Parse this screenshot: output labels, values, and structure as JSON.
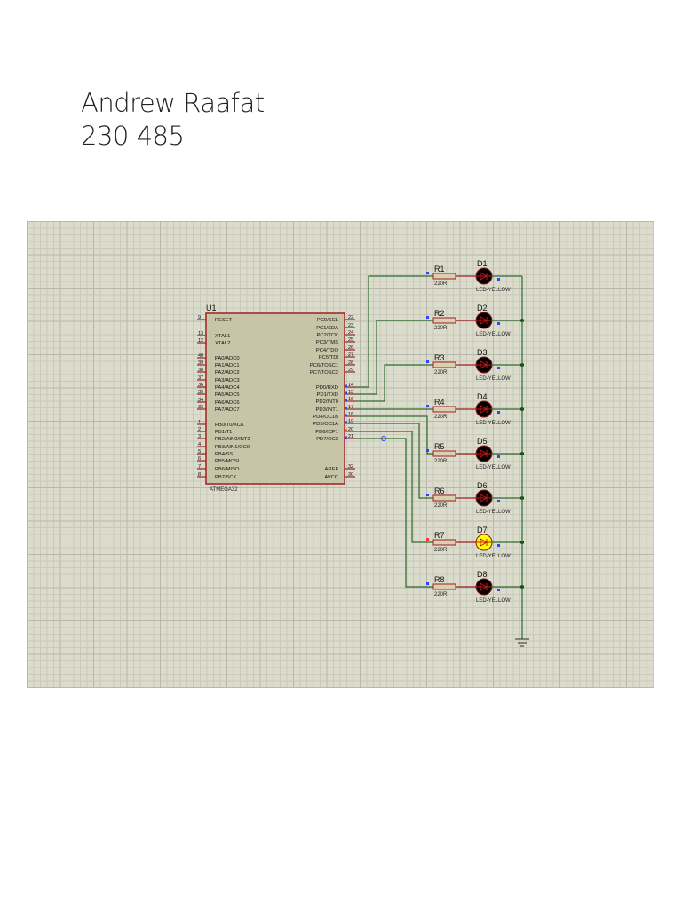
{
  "author": {
    "name": "Andrew Raafat",
    "id": "230 485"
  },
  "schematic": {
    "chip": {
      "ref": "U1",
      "part": "ATMEGA32",
      "left_pins": [
        {
          "num": "9",
          "name": "RESET"
        },
        {
          "num": "13",
          "name": "XTAL1"
        },
        {
          "num": "12",
          "name": "XTAL2"
        },
        {
          "num": "40",
          "name": "PA0/ADC0"
        },
        {
          "num": "39",
          "name": "PA1/ADC1"
        },
        {
          "num": "38",
          "name": "PA2/ADC2"
        },
        {
          "num": "37",
          "name": "PA3/ADC3"
        },
        {
          "num": "36",
          "name": "PA4/ADC4"
        },
        {
          "num": "35",
          "name": "PA5/ADC5"
        },
        {
          "num": "34",
          "name": "PA6/ADC6"
        },
        {
          "num": "33",
          "name": "PA7/ADC7"
        },
        {
          "num": "1",
          "name": "PB0/T0/XCK"
        },
        {
          "num": "2",
          "name": "PB1/T1"
        },
        {
          "num": "3",
          "name": "PB2/AIN0/INT2"
        },
        {
          "num": "4",
          "name": "PB3/AIN1/OC0"
        },
        {
          "num": "5",
          "name": "PB4/SS"
        },
        {
          "num": "6",
          "name": "PB5/MOSI"
        },
        {
          "num": "7",
          "name": "PB6/MISO"
        },
        {
          "num": "8",
          "name": "PB7/SCK"
        }
      ],
      "right_pins": [
        {
          "num": "22",
          "name": "PC0/SCL"
        },
        {
          "num": "23",
          "name": "PC1/SDA"
        },
        {
          "num": "24",
          "name": "PC2/TCK"
        },
        {
          "num": "25",
          "name": "PC3/TMS"
        },
        {
          "num": "26",
          "name": "PC4/TDO"
        },
        {
          "num": "27",
          "name": "PC5/TDI"
        },
        {
          "num": "28",
          "name": "PC6/TOSC1"
        },
        {
          "num": "29",
          "name": "PC7/TOSC2"
        },
        {
          "num": "14",
          "name": "PD0/RXD"
        },
        {
          "num": "15",
          "name": "PD1/TXD"
        },
        {
          "num": "16",
          "name": "PD2/INT0"
        },
        {
          "num": "17",
          "name": "PD3/INT1"
        },
        {
          "num": "18",
          "name": "PD4/OC1B"
        },
        {
          "num": "19",
          "name": "PD5/OC1A"
        },
        {
          "num": "20",
          "name": "PD6/ICP1"
        },
        {
          "num": "21",
          "name": "PD7/OC2"
        },
        {
          "num": "32",
          "name": "AREF"
        },
        {
          "num": "30",
          "name": "AVCC"
        }
      ]
    },
    "channels": [
      {
        "resistor": "R1",
        "value": "220R",
        "led": "D1",
        "led_type": "LED-YELLOW",
        "lit": false
      },
      {
        "resistor": "R2",
        "value": "220R",
        "led": "D2",
        "led_type": "LED-YELLOW",
        "lit": false
      },
      {
        "resistor": "R3",
        "value": "220R",
        "led": "D3",
        "led_type": "LED-YELLOW",
        "lit": false
      },
      {
        "resistor": "R4",
        "value": "220R",
        "led": "D4",
        "led_type": "LED-YELLOW",
        "lit": false
      },
      {
        "resistor": "R5",
        "value": "220R",
        "led": "D5",
        "led_type": "LED-YELLOW",
        "lit": false
      },
      {
        "resistor": "R6",
        "value": "220R",
        "led": "D6",
        "led_type": "LED-YELLOW",
        "lit": false
      },
      {
        "resistor": "R7",
        "value": "220R",
        "led": "D7",
        "led_type": "LED-YELLOW",
        "lit": true
      },
      {
        "resistor": "R8",
        "value": "220R",
        "led": "D8",
        "led_type": "LED-YELLOW",
        "lit": false
      }
    ],
    "colors": {
      "wire": "#2e6b2e",
      "pin": "#a02020",
      "body": "#c8c4a8",
      "led_off": "#000000",
      "led_on": "#ffff00",
      "logic_low": "#3344ff",
      "logic_high": "#ff3333"
    }
  }
}
